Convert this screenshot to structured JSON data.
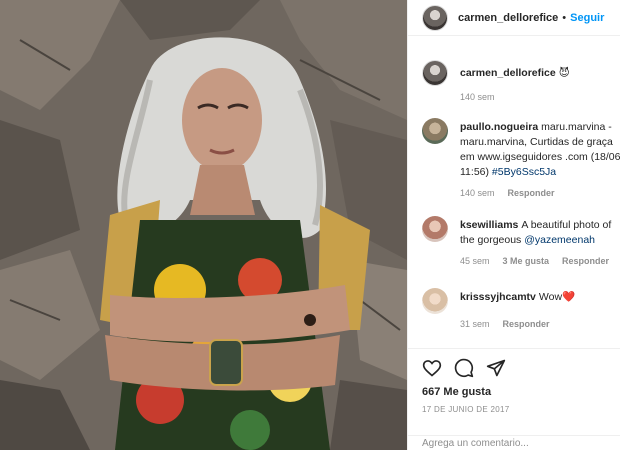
{
  "post_header": {
    "username": "carmen_dellorefice",
    "separator": "•",
    "follow_label": "Seguir"
  },
  "caption": {
    "username": "carmen_dellorefice",
    "emoji": "😈",
    "age": "140 sem"
  },
  "comments": [
    {
      "username": "paullo.nogueira",
      "text_before": "maru.marvina - maru.marvina, Curtidas de graça em www.igseguidores .com (18/06 11:56) ",
      "hashtag": "#5By6Ssc5Ja",
      "age": "140 sem",
      "reply_label": "Responder"
    },
    {
      "username": "ksewilliams",
      "text_before": "A beautiful photo of the gorgeous ",
      "mention": "@yazemeenah",
      "age": "45 sem",
      "likes_label": "3 Me gusta",
      "reply_label": "Responder"
    },
    {
      "username": "krisssyjhcamtv",
      "text_before": "Wow",
      "emoji": "❤️",
      "age": "31 sem",
      "reply_label": "Responder"
    }
  ],
  "actions": {
    "icons": [
      "heart-icon",
      "comment-icon",
      "share-icon"
    ],
    "likes": "667 Me gusta",
    "date": "17 DE JUNIO DE 2017",
    "add_comment_placeholder": "Agrega un comentario..."
  },
  "colors": {
    "link_blue": "#0095f6",
    "tag_blue": "#00376b",
    "muted": "#8e8e8e",
    "text": "#262626",
    "heart_red": "#ed4956"
  }
}
